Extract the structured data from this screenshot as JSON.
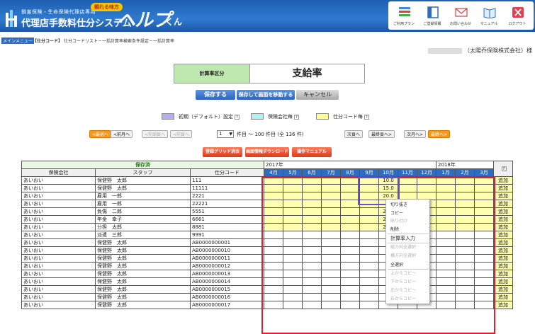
{
  "header": {
    "logo_sub": "損害保険・生命保険代理店専用",
    "logo_main": "代理店手数料仕分システム",
    "badge": "頼れる味方",
    "logo_help": "ヘルプ",
    "logo_kun": "くん",
    "nav": [
      {
        "label": "ご利用プラン",
        "icon": "plan-icon"
      },
      {
        "label": "ご登録情報",
        "icon": "registration-icon"
      },
      {
        "label": "お問い合わせ",
        "icon": "mail-icon"
      },
      {
        "label": "マニュアル",
        "icon": "manual-icon"
      },
      {
        "label": "ログアウト",
        "icon": "logout-icon"
      }
    ]
  },
  "breadcrumb": {
    "home": "メインメニュー",
    "current": "【仕分コード】",
    "rest": "仕分コードリスト－一括計算率検索条件設定－一括計算率"
  },
  "company": "（太陽乔保険株式会社）様",
  "calc": {
    "label": "計算率区分",
    "value": "支給率"
  },
  "buttons": {
    "save": "保存する",
    "save_move": "保存して画面を移動する",
    "cancel": "キャンセル"
  },
  "legend": {
    "default": "初期（デフォルト）設定",
    "company": "保険会社毎",
    "code": "仕分コード毎",
    "q": "?",
    "colors": {
      "default": "#b0b0f0",
      "company": "#b0f0f0",
      "code": "#ffff90"
    }
  },
  "pager": {
    "first": "最初へ",
    "prev": "前月へ",
    "prev_page": "先頭頁へ",
    "prev2": "前頁へ",
    "page_val": "1",
    "count_text": "件目 ～ 100 件目 (全 136 件)",
    "next": "次頁へ",
    "last_page": "最終頁へ",
    "next_month": "次月へ",
    "last": "最終へ"
  },
  "actions": {
    "clear": "登録グリッド消去",
    "download": "画面情報ダウンロード",
    "manual": "操作マニュアル"
  },
  "grid": {
    "saved_label": "保存済",
    "year1": "2017年",
    "year2": "2018年",
    "help": "?",
    "cols": [
      "保険会社",
      "スタッフ",
      "仕分コード"
    ],
    "months": [
      "4月",
      "5月",
      "6月",
      "7月",
      "8月",
      "9月",
      "10月",
      "11月",
      "12月",
      "1月",
      "2月",
      "3月"
    ],
    "add_label": "追加",
    "rows": [
      {
        "company": "あいおい",
        "staff": "保健野　太郎",
        "code": "111",
        "oct": "10.0",
        "yellow": true
      },
      {
        "company": "あいおい",
        "staff": "保健野　太郎",
        "code": "11111",
        "oct": "15.0",
        "yellow": true
      },
      {
        "company": "あいおい",
        "staff": "雇用　一郎",
        "code": "2221",
        "oct": "20.0",
        "yellow": true
      },
      {
        "company": "あいおい",
        "staff": "雇用　一郎",
        "code": "22221",
        "oct": "",
        "yellow": true
      },
      {
        "company": "あいおい",
        "staff": "負傷　二郎",
        "code": "5551",
        "oct": "20.0",
        "yellow": true
      },
      {
        "company": "あいおい",
        "staff": "年金　幸子",
        "code": "6661",
        "oct": "20.0",
        "yellow": true
      },
      {
        "company": "あいおい",
        "staff": "分担　太郎",
        "code": "8881",
        "oct": "20.0",
        "yellow": true
      },
      {
        "company": "あいおい",
        "staff": "派遣　三郎",
        "code": "9991",
        "oct": "",
        "yellow": false
      },
      {
        "company": "あいおい",
        "staff": "保健野　太郎",
        "code": "AB0000000001",
        "oct": "",
        "yellow": false
      },
      {
        "company": "あいおい",
        "staff": "保健野　太郎",
        "code": "AB0000000010",
        "oct": "",
        "yellow": false
      },
      {
        "company": "あいおい",
        "staff": "保健野　太郎",
        "code": "AB0000000011",
        "oct": "",
        "yellow": false
      },
      {
        "company": "あいおい",
        "staff": "保健野　太郎",
        "code": "AB0000000012",
        "oct": "",
        "yellow": false
      },
      {
        "company": "あいおい",
        "staff": "保健野　太郎",
        "code": "AB0000000013",
        "oct": "",
        "yellow": false
      },
      {
        "company": "あいおい",
        "staff": "保健野　太郎",
        "code": "AB0000000014",
        "oct": "",
        "yellow": false
      },
      {
        "company": "あいおい",
        "staff": "保健野　太郎",
        "code": "AB0000000015",
        "oct": "",
        "yellow": false
      },
      {
        "company": "あいおい",
        "staff": "保健野　太郎",
        "code": "AB0000000016",
        "oct": "",
        "yellow": false
      },
      {
        "company": "あいおい",
        "staff": "保健野　太郎",
        "code": "AB0000000017",
        "oct": "",
        "yellow": false
      }
    ]
  },
  "menu": [
    {
      "label": "切り抜き",
      "enabled": true
    },
    {
      "label": "コピー",
      "enabled": true
    },
    {
      "label": "貼り付け",
      "enabled": false
    },
    {
      "label": "削除",
      "enabled": true
    },
    {
      "label": "計算率入力",
      "enabled": true
    },
    {
      "label": "縦方向全選択",
      "enabled": false
    },
    {
      "label": "横方向全選択",
      "enabled": false
    },
    {
      "label": "全選択",
      "enabled": true
    },
    {
      "label": "上からコピー",
      "enabled": false
    },
    {
      "label": "下からコピー",
      "enabled": false
    },
    {
      "label": "左からコピー",
      "enabled": false
    },
    {
      "label": "右からコピー",
      "enabled": false
    }
  ]
}
